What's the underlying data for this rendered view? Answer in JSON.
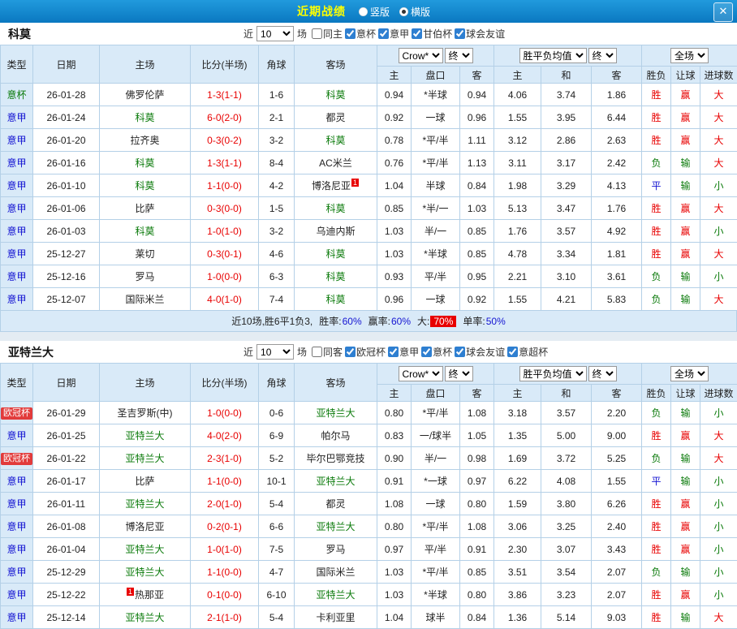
{
  "titlebar": {
    "title": "近期战绩",
    "radios": [
      {
        "label": "竖版",
        "selected": false
      },
      {
        "label": "横版",
        "selected": true
      }
    ],
    "close_icon": "✕"
  },
  "table_header": {
    "type": "类型",
    "date": "日期",
    "home": "主场",
    "score": "比分(半场)",
    "corner": "角球",
    "away": "客场",
    "odds_company": "Crow*",
    "odds_time": "终",
    "avg_label": "胜平负均值",
    "avg_time": "终",
    "scope": "全场",
    "sub": [
      "主",
      "盘口",
      "客",
      "主",
      "和",
      "客",
      "胜负",
      "让球",
      "进球数"
    ]
  },
  "colors": {
    "titlebar_blue": "#0a78c0",
    "title_yellow": "#ffff00",
    "header_bg": "#d9eaf8",
    "border_blue": "#b4d0e7",
    "win_red": "#e80000",
    "draw_blue": "#1414d2",
    "loss_green": "#0a7a0a",
    "focal_team_green": "#0a7a0a",
    "score_red": "#e80000",
    "cup_badge_bg": "#e23b3b"
  },
  "sections": [
    {
      "team": "科莫",
      "filter": {
        "near": "近",
        "count": "10",
        "games": "场",
        "checkboxes": [
          {
            "label": "同主",
            "checked": false
          },
          {
            "label": "意杯",
            "checked": true
          },
          {
            "label": "意甲",
            "checked": true
          },
          {
            "label": "甘伯杯",
            "checked": true
          },
          {
            "label": "球会友谊",
            "checked": true
          }
        ]
      },
      "rows": [
        {
          "league": "意杯",
          "date": "26-01-28",
          "home": "佛罗伦萨",
          "score": "1-3(1-1)",
          "corner": "1-6",
          "away": "科莫",
          "odds_home": "0.94",
          "handicap": "*半球",
          "odds_away": "0.94",
          "avg_home": "4.06",
          "avg_draw": "3.74",
          "avg_away": "1.86",
          "result": "胜",
          "handicap_result": "赢",
          "goals": "大"
        },
        {
          "league": "意甲",
          "date": "26-01-24",
          "home": "科莫",
          "score": "6-0(2-0)",
          "corner": "2-1",
          "away": "都灵",
          "odds_home": "0.92",
          "handicap": "一球",
          "odds_away": "0.96",
          "avg_home": "1.55",
          "avg_draw": "3.95",
          "avg_away": "6.44",
          "result": "胜",
          "handicap_result": "赢",
          "goals": "大"
        },
        {
          "league": "意甲",
          "date": "26-01-20",
          "home": "拉齐奥",
          "score": "0-3(0-2)",
          "corner": "3-2",
          "away": "科莫",
          "odds_home": "0.78",
          "handicap": "*平/半",
          "odds_away": "1.11",
          "avg_home": "3.12",
          "avg_draw": "2.86",
          "avg_away": "2.63",
          "result": "胜",
          "handicap_result": "赢",
          "goals": "大"
        },
        {
          "league": "意甲",
          "date": "26-01-16",
          "home": "科莫",
          "score": "1-3(1-1)",
          "corner": "8-4",
          "away": "AC米兰",
          "odds_home": "0.76",
          "handicap": "*平/半",
          "odds_away": "1.13",
          "avg_home": "3.11",
          "avg_draw": "3.17",
          "avg_away": "2.42",
          "result": "负",
          "handicap_result": "输",
          "goals": "大"
        },
        {
          "league": "意甲",
          "date": "26-01-10",
          "home": "科莫",
          "score": "1-1(0-0)",
          "corner": "4-2",
          "away": "博洛尼亚",
          "away_badge": "1",
          "away_badge_pos": "after",
          "odds_home": "1.04",
          "handicap": "半球",
          "odds_away": "0.84",
          "avg_home": "1.98",
          "avg_draw": "3.29",
          "avg_away": "4.13",
          "result": "平",
          "handicap_result": "输",
          "goals": "小"
        },
        {
          "league": "意甲",
          "date": "26-01-06",
          "home": "比萨",
          "score": "0-3(0-0)",
          "corner": "1-5",
          "away": "科莫",
          "odds_home": "0.85",
          "handicap": "*半/一",
          "odds_away": "1.03",
          "avg_home": "5.13",
          "avg_draw": "3.47",
          "avg_away": "1.76",
          "result": "胜",
          "handicap_result": "赢",
          "goals": "大"
        },
        {
          "league": "意甲",
          "date": "26-01-03",
          "home": "科莫",
          "score": "1-0(1-0)",
          "corner": "3-2",
          "away": "乌迪内斯",
          "odds_home": "1.03",
          "handicap": "半/一",
          "odds_away": "0.85",
          "avg_home": "1.76",
          "avg_draw": "3.57",
          "avg_away": "4.92",
          "result": "胜",
          "handicap_result": "赢",
          "goals": "小"
        },
        {
          "league": "意甲",
          "date": "25-12-27",
          "home": "莱切",
          "score": "0-3(0-1)",
          "corner": "4-6",
          "away": "科莫",
          "odds_home": "1.03",
          "handicap": "*半球",
          "odds_away": "0.85",
          "avg_home": "4.78",
          "avg_draw": "3.34",
          "avg_away": "1.81",
          "result": "胜",
          "handicap_result": "赢",
          "goals": "大"
        },
        {
          "league": "意甲",
          "date": "25-12-16",
          "home": "罗马",
          "score": "1-0(0-0)",
          "corner": "6-3",
          "away": "科莫",
          "odds_home": "0.93",
          "handicap": "平/半",
          "odds_away": "0.95",
          "avg_home": "2.21",
          "avg_draw": "3.10",
          "avg_away": "3.61",
          "result": "负",
          "handicap_result": "输",
          "goals": "小"
        },
        {
          "league": "意甲",
          "date": "25-12-07",
          "home": "国际米兰",
          "score": "4-0(1-0)",
          "corner": "7-4",
          "away": "科莫",
          "odds_home": "0.96",
          "handicap": "一球",
          "odds_away": "0.92",
          "avg_home": "1.55",
          "avg_draw": "4.21",
          "avg_away": "5.83",
          "result": "负",
          "handicap_result": "输",
          "goals": "大"
        }
      ],
      "summary": {
        "prefix": "近10场,胜6平1负3,",
        "stats": [
          {
            "label": "胜率:",
            "value": "60%",
            "highlight": false
          },
          {
            "label": "赢率:",
            "value": "60%",
            "highlight": false
          },
          {
            "label": "大:",
            "value": "70%",
            "highlight": true
          },
          {
            "label": "单率:",
            "value": "50%",
            "highlight": false
          }
        ]
      }
    },
    {
      "team": "亚特兰大",
      "filter": {
        "near": "近",
        "count": "10",
        "games": "场",
        "checkboxes": [
          {
            "label": "同客",
            "checked": false
          },
          {
            "label": "欧冠杯",
            "checked": true
          },
          {
            "label": "意甲",
            "checked": true
          },
          {
            "label": "意杯",
            "checked": true
          },
          {
            "label": "球会友谊",
            "checked": true
          },
          {
            "label": "意超杯",
            "checked": true
          }
        ]
      },
      "rows": [
        {
          "league": "欧冠杯",
          "date": "26-01-29",
          "home": "圣吉罗斯(中)",
          "score": "1-0(0-0)",
          "corner": "0-6",
          "away": "亚特兰大",
          "odds_home": "0.80",
          "handicap": "*平/半",
          "odds_away": "1.08",
          "avg_home": "3.18",
          "avg_draw": "3.57",
          "avg_away": "2.20",
          "result": "负",
          "handicap_result": "输",
          "goals": "小"
        },
        {
          "league": "意甲",
          "date": "26-01-25",
          "home": "亚特兰大",
          "score": "4-0(2-0)",
          "corner": "6-9",
          "away": "帕尔马",
          "odds_home": "0.83",
          "handicap": "一/球半",
          "odds_away": "1.05",
          "avg_home": "1.35",
          "avg_draw": "5.00",
          "avg_away": "9.00",
          "result": "胜",
          "handicap_result": "赢",
          "goals": "大"
        },
        {
          "league": "欧冠杯",
          "date": "26-01-22",
          "home": "亚特兰大",
          "score": "2-3(1-0)",
          "corner": "5-2",
          "away": "毕尔巴鄂竞技",
          "odds_home": "0.90",
          "handicap": "半/一",
          "odds_away": "0.98",
          "avg_home": "1.69",
          "avg_draw": "3.72",
          "avg_away": "5.25",
          "result": "负",
          "handicap_result": "输",
          "goals": "大"
        },
        {
          "league": "意甲",
          "date": "26-01-17",
          "home": "比萨",
          "score": "1-1(0-0)",
          "corner": "10-1",
          "away": "亚特兰大",
          "odds_home": "0.91",
          "handicap": "*一球",
          "odds_away": "0.97",
          "avg_home": "6.22",
          "avg_draw": "4.08",
          "avg_away": "1.55",
          "result": "平",
          "handicap_result": "输",
          "goals": "小"
        },
        {
          "league": "意甲",
          "date": "26-01-11",
          "home": "亚特兰大",
          "score": "2-0(1-0)",
          "corner": "5-4",
          "away": "都灵",
          "odds_home": "1.08",
          "handicap": "一球",
          "odds_away": "0.80",
          "avg_home": "1.59",
          "avg_draw": "3.80",
          "avg_away": "6.26",
          "result": "胜",
          "handicap_result": "赢",
          "goals": "小"
        },
        {
          "league": "意甲",
          "date": "26-01-08",
          "home": "博洛尼亚",
          "score": "0-2(0-1)",
          "corner": "6-6",
          "away": "亚特兰大",
          "odds_home": "0.80",
          "handicap": "*平/半",
          "odds_away": "1.08",
          "avg_home": "3.06",
          "avg_draw": "3.25",
          "avg_away": "2.40",
          "result": "胜",
          "handicap_result": "赢",
          "goals": "小"
        },
        {
          "league": "意甲",
          "date": "26-01-04",
          "home": "亚特兰大",
          "score": "1-0(1-0)",
          "corner": "7-5",
          "away": "罗马",
          "odds_home": "0.97",
          "handicap": "平/半",
          "odds_away": "0.91",
          "avg_home": "2.30",
          "avg_draw": "3.07",
          "avg_away": "3.43",
          "result": "胜",
          "handicap_result": "赢",
          "goals": "小"
        },
        {
          "league": "意甲",
          "date": "25-12-29",
          "home": "亚特兰大",
          "score": "1-1(0-0)",
          "corner": "4-7",
          "away": "国际米兰",
          "odds_home": "1.03",
          "handicap": "*平/半",
          "odds_away": "0.85",
          "avg_home": "3.51",
          "avg_draw": "3.54",
          "avg_away": "2.07",
          "result": "负",
          "handicap_result": "输",
          "goals": "小"
        },
        {
          "league": "意甲",
          "date": "25-12-22",
          "home": "热那亚",
          "home_badge": "1",
          "home_badge_pos": "before",
          "score": "0-1(0-0)",
          "corner": "6-10",
          "away": "亚特兰大",
          "odds_home": "1.03",
          "handicap": "*半球",
          "odds_away": "0.80",
          "avg_home": "3.86",
          "avg_draw": "3.23",
          "avg_away": "2.07",
          "result": "胜",
          "handicap_result": "赢",
          "goals": "小"
        },
        {
          "league": "意甲",
          "date": "25-12-14",
          "home": "亚特兰大",
          "score": "2-1(1-0)",
          "corner": "5-4",
          "away": "卡利亚里",
          "odds_home": "1.04",
          "handicap": "球半",
          "odds_away": "0.84",
          "avg_home": "1.36",
          "avg_draw": "5.14",
          "avg_away": "9.03",
          "result": "胜",
          "handicap_result": "输",
          "goals": "大"
        }
      ],
      "summary": null
    }
  ]
}
